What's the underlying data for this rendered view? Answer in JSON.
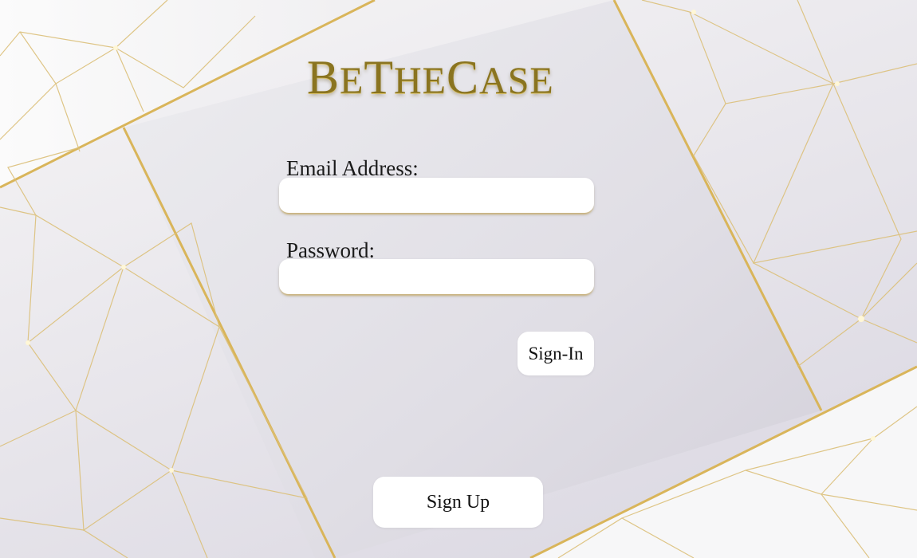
{
  "brand": {
    "logo_text_parts": [
      "B",
      "E",
      "T",
      "HE",
      "C",
      "ASE"
    ],
    "logo_color": "#8a7420"
  },
  "form": {
    "email": {
      "label": "Email Address:",
      "value": "",
      "placeholder": ""
    },
    "password": {
      "label": "Password:",
      "value": "",
      "placeholder": ""
    },
    "sign_in_label": "Sign-In"
  },
  "sign_up_label": "Sign Up",
  "colors": {
    "gold_line": "#d9b55a",
    "panel": "#e4e2e8",
    "button_bg": "#ffffff"
  }
}
